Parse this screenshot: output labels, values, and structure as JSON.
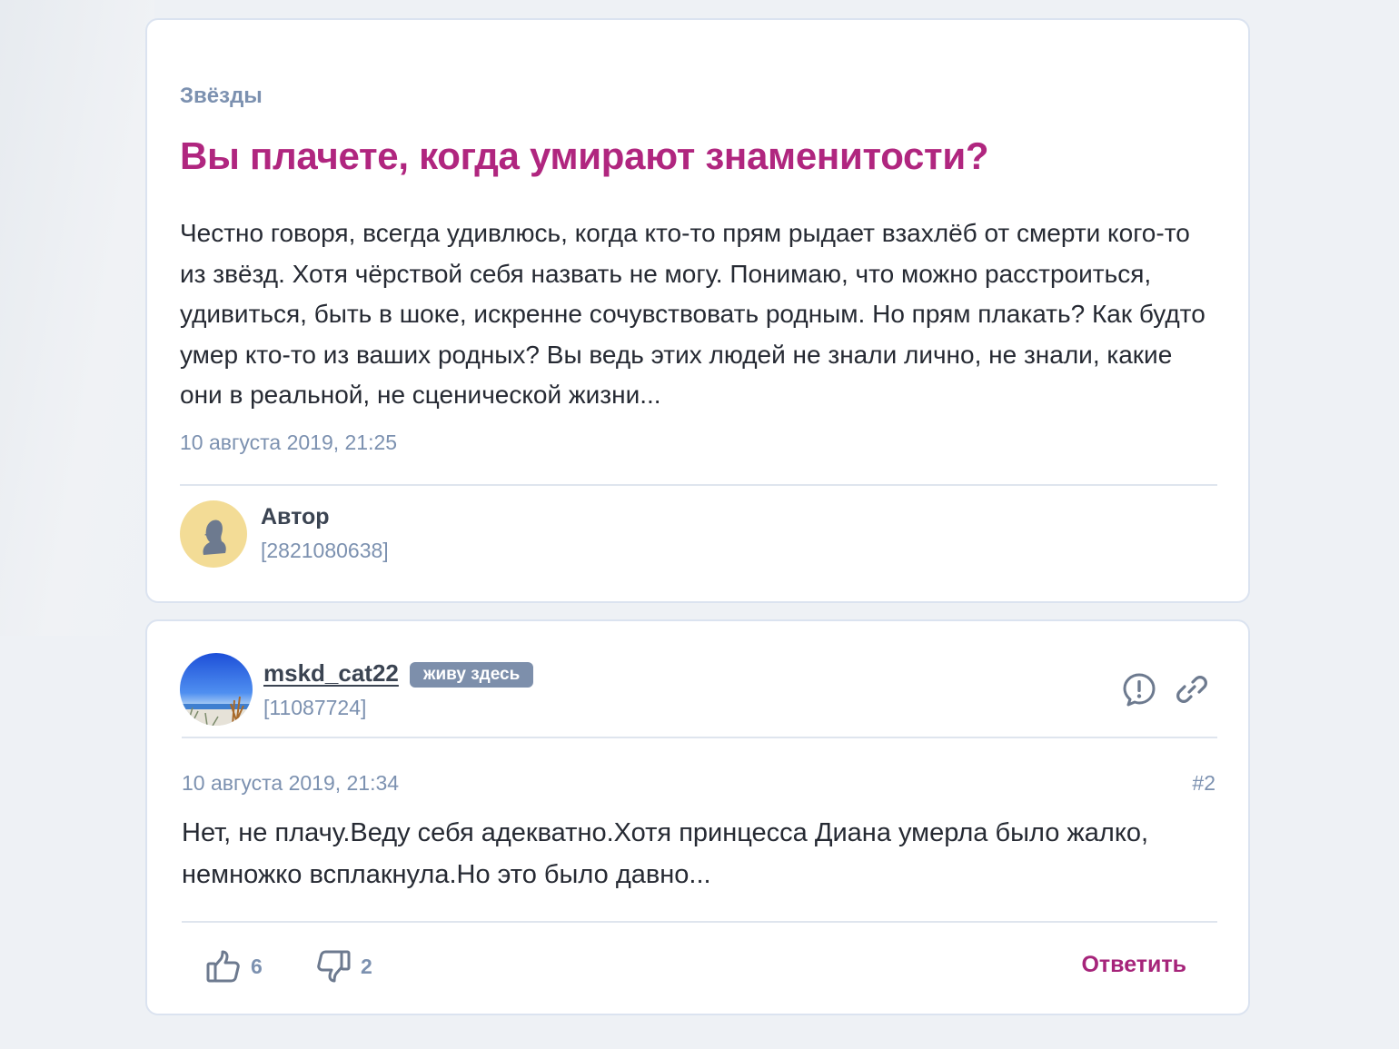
{
  "question": {
    "category": "Звёзды",
    "title": "Вы плачете, когда умирают знаменитости?",
    "body": "Честно говоря, всегда удивлюсь, когда кто-то прям рыдает взахлёб от смерти кого-то из звёзд. Хотя чёрствой себя назвать не могу. Понимаю, что можно расстроиться, удивиться, быть в шоке, искренне сочувствовать родным. Но прям плакать? Как будто умер кто-то из ваших родных? Вы ведь этих людей не знали лично, не знали, какие они в реальной, не сценической жизни...",
    "date": "10 августа 2019, 21:25",
    "author": {
      "name": "Автор",
      "id": "[2821080638]",
      "avatar_icon": "anonymous-user-icon",
      "avatar_color": "#f3dc96"
    }
  },
  "answer": {
    "user": {
      "name": "mskd_cat22",
      "badge": "живу здесь",
      "id": "[11087724]",
      "avatar_icon": "beach-photo-avatar"
    },
    "actions": {
      "report_icon": "report-icon",
      "link_icon": "link-icon"
    },
    "date": "10 августа 2019, 21:34",
    "number": "#2",
    "body": "Нет, не плачу.Веду себя адекватно.Хотя принцесса Диана умерла было жалко, немножко всплакнула.Но это было давно...",
    "likes": "6",
    "dislikes": "2",
    "reply_label": "Ответить"
  },
  "colors": {
    "accent": "#b0267f",
    "muted": "#7c91b0",
    "text": "#262a33",
    "badge": "#7d8fab",
    "page_bg": "#eef1f5"
  }
}
